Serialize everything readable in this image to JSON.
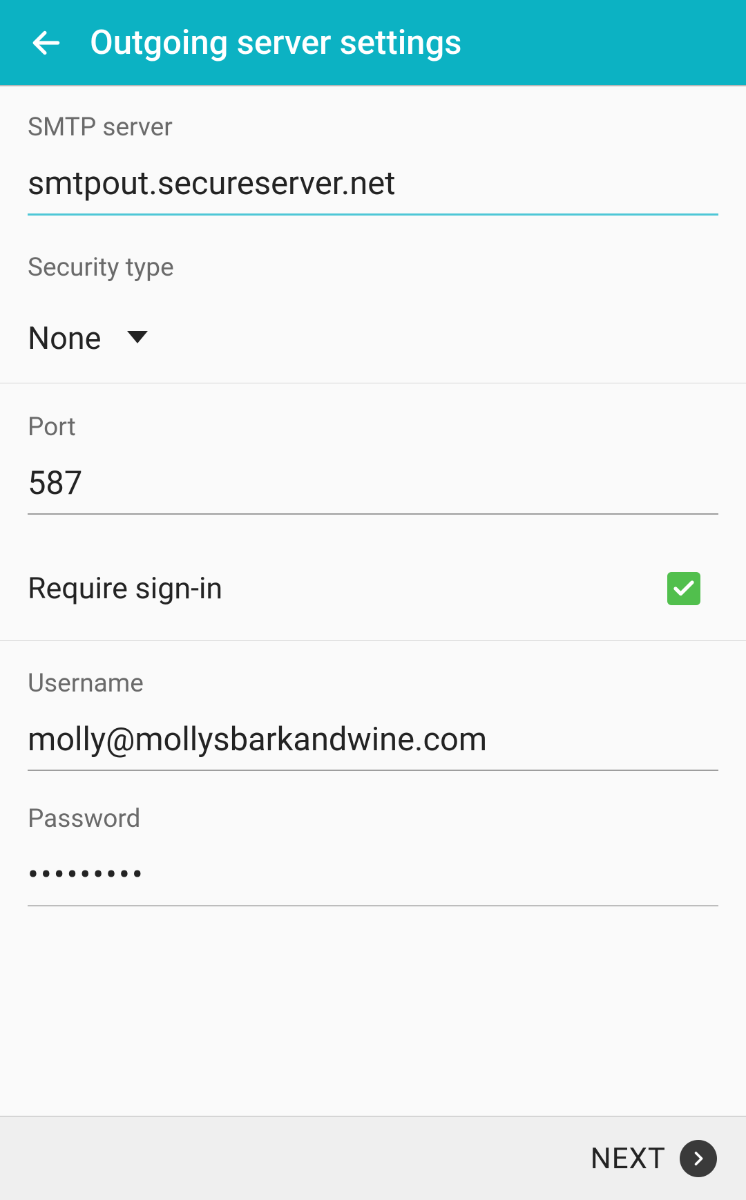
{
  "header": {
    "title": "Outgoing server settings"
  },
  "fields": {
    "smtp_label": "SMTP server",
    "smtp_value": "smtpout.secureserver.net",
    "security_label": "Security type",
    "security_value": "None",
    "port_label": "Port",
    "port_value": "587",
    "signin_label": "Require sign-in",
    "username_label": "Username",
    "username_value": "molly@mollysbarkandwine.com",
    "password_label": "Password",
    "password_value": "•••••••••"
  },
  "footer": {
    "next_label": "NEXT"
  }
}
